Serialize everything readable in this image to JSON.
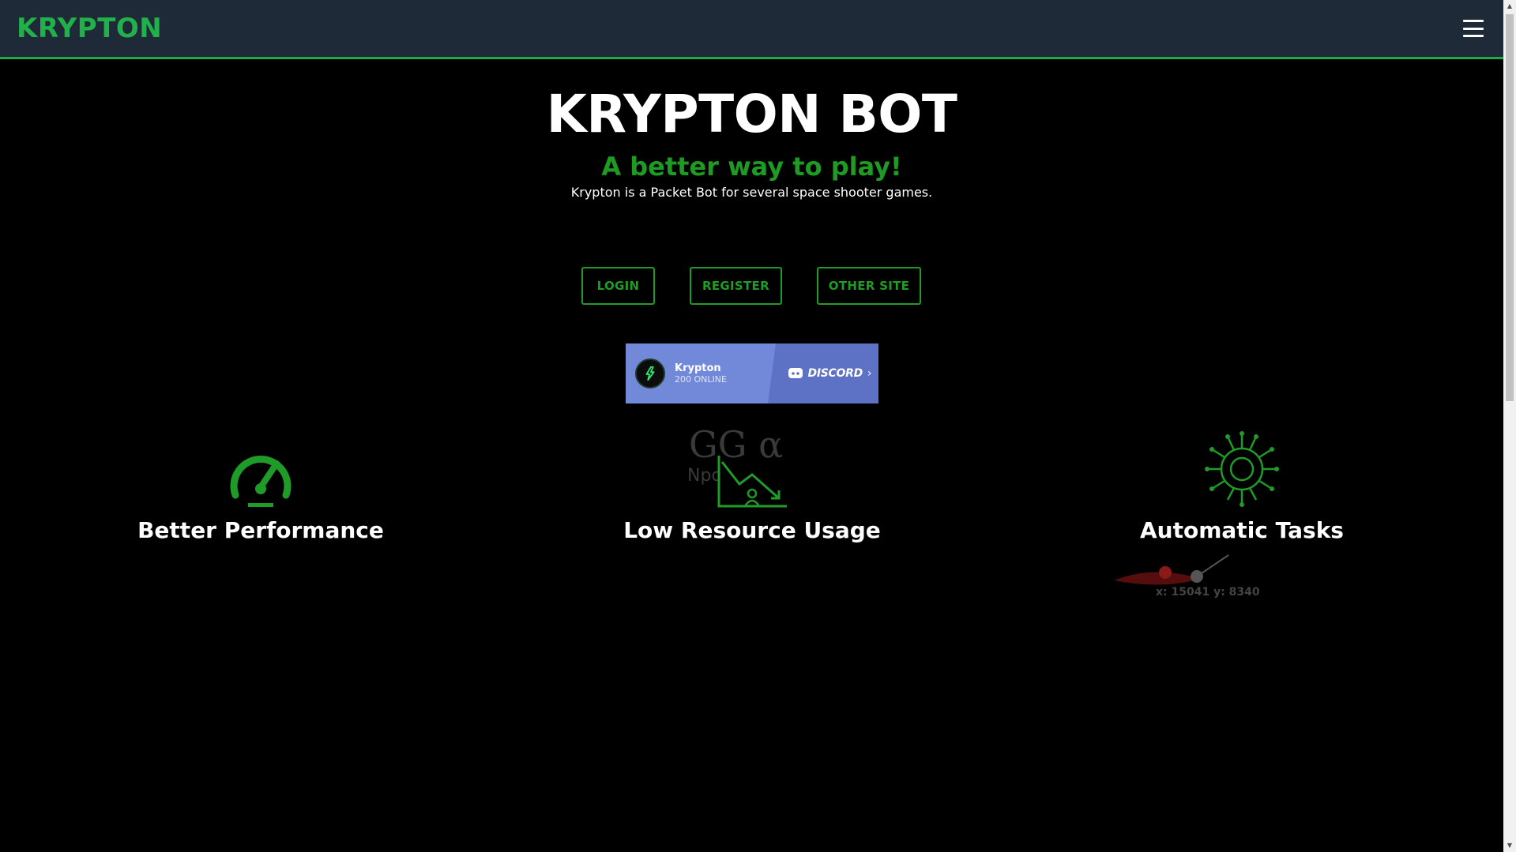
{
  "nav": {
    "brand": "KRYPTON",
    "menu_icon": "hamburger-menu-icon"
  },
  "hero": {
    "title": "KRYPTON BOT",
    "subtitle": "A better way to play!",
    "description": "Krypton is a Packet Bot for several space shooter games."
  },
  "buttons": {
    "login": "LOGIN",
    "register": "REGISTER",
    "other": "OTHER SITE"
  },
  "discord": {
    "server_name": "Krypton",
    "online": "200 ONLINE",
    "label": "DISCORD"
  },
  "features": [
    {
      "label": "Better Performance",
      "icon": "speedometer-icon"
    },
    {
      "label": "Low Resource Usage",
      "icon": "declining-chart-icon"
    },
    {
      "label": "Automatic Tasks",
      "icon": "brain-circuit-icon"
    }
  ],
  "overlay": {
    "ghost_text_1": "GG α",
    "ghost_text_2": "Npc",
    "coords": "x: 15041 y: 8340"
  },
  "colors": {
    "accent": "#22b04b",
    "button_green": "#1f9b28",
    "navbar": "#1e2a38",
    "discord": "#7289da"
  }
}
